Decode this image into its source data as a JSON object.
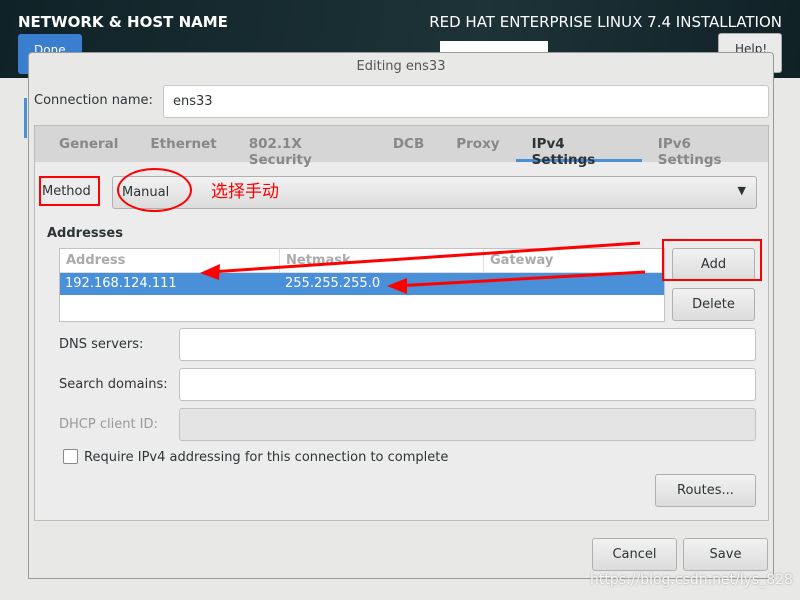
{
  "header": {
    "title": "NETWORK & HOST NAME",
    "product": "RED HAT ENTERPRISE LINUX 7.4 INSTALLATION",
    "done": "Done",
    "help": "Help!"
  },
  "dialog": {
    "title": "Editing ens33",
    "connection_name_label": "Connection name:",
    "connection_name": "ens33",
    "tabs": [
      "General",
      "Ethernet",
      "802.1X Security",
      "DCB",
      "Proxy",
      "IPv4 Settings",
      "IPv6 Settings"
    ],
    "active_tab": "IPv4 Settings",
    "method_label": "Method",
    "method_value": "Manual",
    "annotation": "选择手动",
    "addresses_label": "Addresses",
    "columns": [
      "Address",
      "Netmask",
      "Gateway"
    ],
    "rows": [
      [
        "192.168.124.111",
        "255.255.255.0",
        ""
      ]
    ],
    "add": "Add",
    "delete": "Delete",
    "dns_label": "DNS servers:",
    "dns": "",
    "search_label": "Search domains:",
    "search": "",
    "dhcp_label": "DHCP client ID:",
    "require_label": "Require IPv4 addressing for this connection to complete",
    "require_checked": false,
    "routes": "Routes...",
    "cancel": "Cancel",
    "save": "Save"
  },
  "watermark": "https://blog.csdn.net/lys_828",
  "colors": {
    "accent": "#4a90d9",
    "annotation": "#ff0000"
  }
}
